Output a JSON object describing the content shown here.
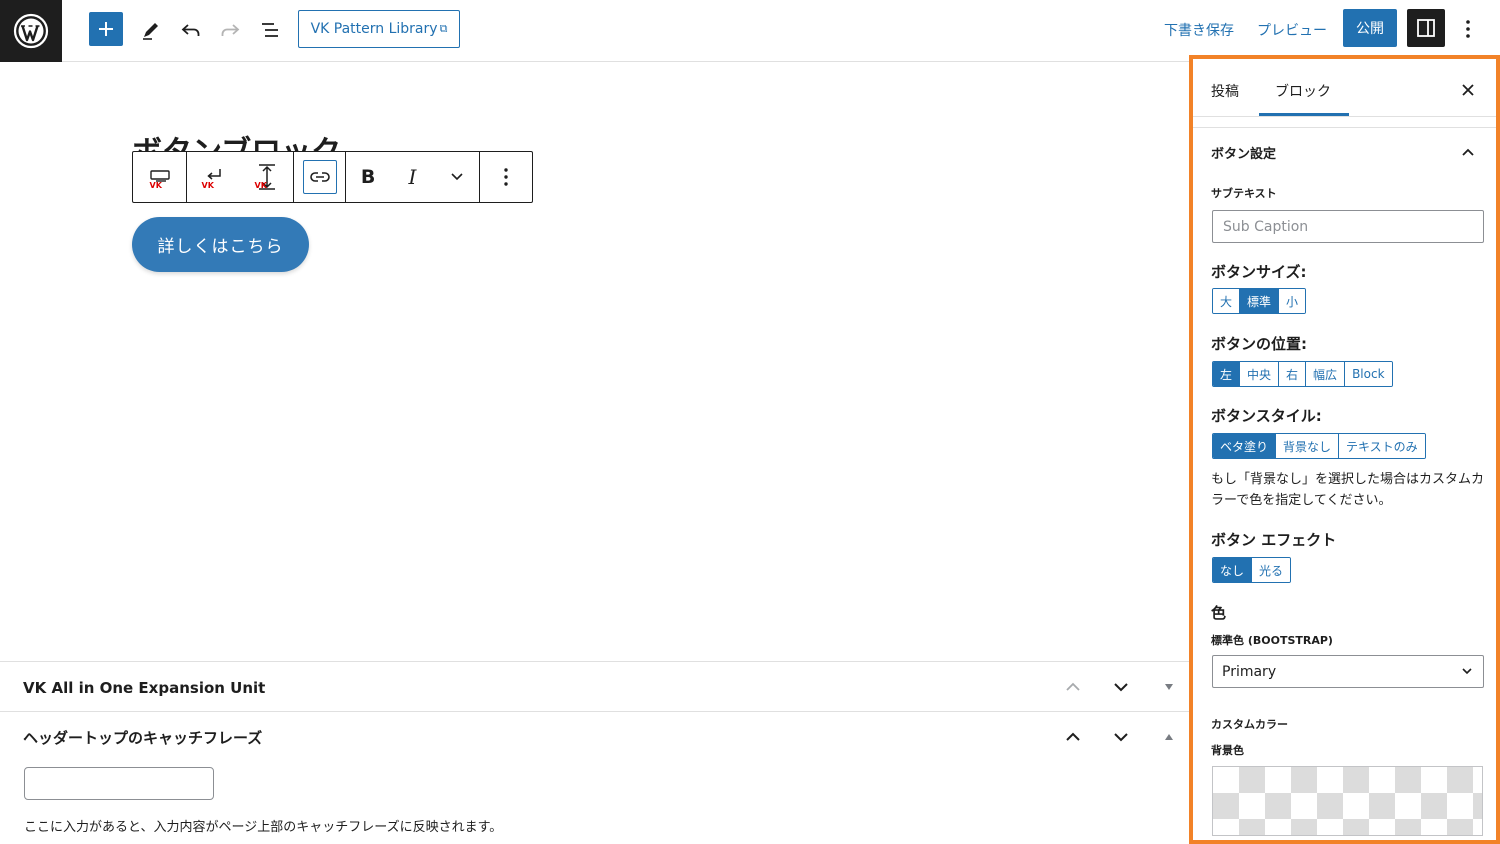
{
  "topbar": {
    "pattern_library_label": "VK Pattern Library",
    "pattern_library_ext_glyph": "⧉",
    "save_draft_label": "下書き保存",
    "preview_label": "プレビュー",
    "publish_label": "公開"
  },
  "canvas": {
    "post_title": "ボタンブロック",
    "vk_mark": "VK",
    "bold_glyph": "B",
    "italic_glyph": "I",
    "button_text": "詳しくはこちら"
  },
  "metaboxes": {
    "vk_unit_title": "VK All in One Expansion Unit",
    "catchphrase_title": "ヘッダートップのキャッチフレーズ",
    "catchphrase_value": "",
    "catchphrase_help": "ここに入力があると、入力内容がページ上部のキャッチフレーズに反映されます。"
  },
  "sidebar": {
    "tab_post": "投稿",
    "tab_block": "ブロック",
    "active_tab": "ブロック",
    "panel_title": "ボタン設定",
    "subtext_label": "サブテキスト",
    "subtext_placeholder": "Sub Caption",
    "size_label": "ボタンサイズ:",
    "size_options": [
      "大",
      "標準",
      "小"
    ],
    "size_selected": "標準",
    "position_label": "ボタンの位置:",
    "position_options": [
      "左",
      "中央",
      "右",
      "幅広",
      "Block"
    ],
    "position_selected": "左",
    "style_label": "ボタンスタイル:",
    "style_options": [
      "ベタ塗り",
      "背景なし",
      "テキストのみ"
    ],
    "style_selected": "ベタ塗り",
    "style_note": "もし「背景なし」を選択した場合はカスタムカラーで色を指定してください。",
    "effect_label": "ボタン エフェクト",
    "effect_options": [
      "なし",
      "光る"
    ],
    "effect_selected": "なし",
    "color_label": "色",
    "standard_color_label": "標準色 (BOOTSTRAP)",
    "standard_color_value": "Primary",
    "custom_color_label": "カスタムカラー",
    "bg_color_label": "背景色"
  },
  "colors": {
    "accent": "#2271b1",
    "button_bg": "#337ab7",
    "highlight_border": "#f28228",
    "dark": "#1e1e1e"
  }
}
